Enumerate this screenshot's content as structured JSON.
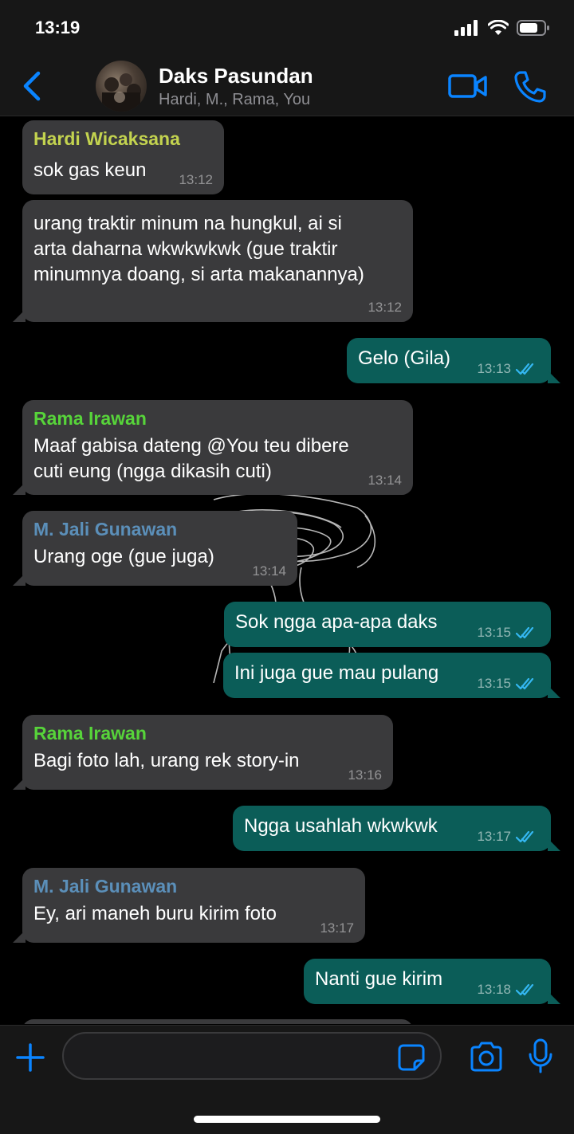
{
  "status_bar": {
    "time": "13:19"
  },
  "header": {
    "title": "Daks Pasundan",
    "subtitle": "Hardi, M., Rama, You"
  },
  "colors": {
    "accent": "#0a84ff",
    "outgoing_bubble": "#0b5d58",
    "incoming_bubble": "#3a3a3c",
    "sender_hardi": "#c3d34f",
    "sender_rama": "#57d43a",
    "sender_jali": "#5b8fb9",
    "read_ticks": "#34b7f1"
  },
  "icons": [
    "back-chevron-icon",
    "video-call-icon",
    "phone-call-icon",
    "plus-icon",
    "sticker-icon",
    "camera-icon",
    "microphone-icon"
  ],
  "messages": [
    {
      "direction": "in",
      "sender": "Hardi Wicaksana",
      "lines": [
        "sok gas keun"
      ],
      "time": "13:12"
    },
    {
      "direction": "in",
      "lines": [
        "urang traktir minum na hungkul, ai si",
        "arta daharna wkwkwkwk (gue traktir",
        "minumnya doang, si arta makanannya)"
      ],
      "time": "13:12"
    },
    {
      "direction": "out",
      "lines": [
        "Gelo (Gila)"
      ],
      "time": "13:13",
      "read": true
    },
    {
      "direction": "in",
      "sender": "Rama Irawan",
      "lines": [
        "Maaf gabisa dateng @You teu dibere",
        "cuti eung (ngga dikasih cuti)"
      ],
      "time": "13:14"
    },
    {
      "direction": "in",
      "sender": "M. Jali Gunawan",
      "lines": [
        "Urang oge (gue juga)"
      ],
      "time": "13:14"
    },
    {
      "direction": "out",
      "lines": [
        "Sok ngga apa-apa daks"
      ],
      "time": "13:15",
      "read": true
    },
    {
      "direction": "out",
      "lines": [
        "Ini juga gue mau pulang"
      ],
      "time": "13:15",
      "read": true
    },
    {
      "direction": "in",
      "sender": "Rama Irawan",
      "lines": [
        "Bagi foto lah, urang rek story-in"
      ],
      "time": "13:16"
    },
    {
      "direction": "out",
      "lines": [
        "Ngga usahlah wkwkwk"
      ],
      "time": "13:17",
      "read": true
    },
    {
      "direction": "in",
      "sender": "M. Jali Gunawan",
      "lines": [
        "Ey, ari maneh buru kirim foto"
      ],
      "time": "13:17"
    },
    {
      "direction": "out",
      "lines": [
        "Nanti gue kirim"
      ],
      "time": "13:18",
      "read": true
    }
  ]
}
